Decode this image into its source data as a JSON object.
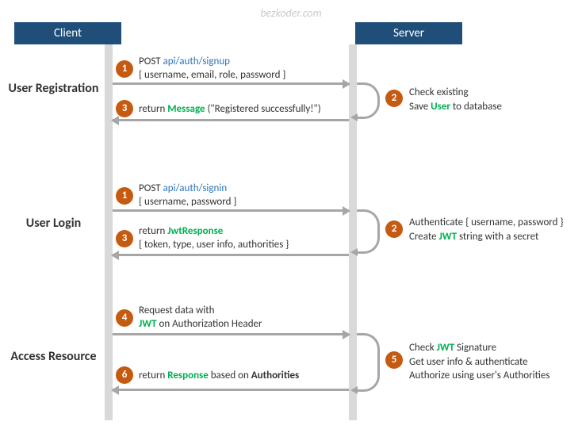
{
  "watermark": "bezkoder.com",
  "headers": {
    "client": "Client",
    "server": "Server"
  },
  "sections": {
    "registration": "User Registration",
    "login": "User Login",
    "access": "Access Resource"
  },
  "badges": {
    "b1": "1",
    "b2": "2",
    "b3": "3",
    "b4": "4",
    "b5": "5",
    "b6": "6"
  },
  "reg": {
    "step1": {
      "method": "POST ",
      "endpoint": "api/auth/signup",
      "body": "{ username, email, role, password }"
    },
    "step2": {
      "line1": "Check existing",
      "save_pre": "Save ",
      "save_hl": "User",
      "save_post": " to database"
    },
    "step3": {
      "ret": "return ",
      "hl": "Message",
      "post": " (\"Registered successfully!\")"
    }
  },
  "login": {
    "step1": {
      "method": "POST ",
      "endpoint": "api/auth/signin",
      "body": "{ username, password }"
    },
    "step2": {
      "line1": "Authenticate { username, password }",
      "create_pre": "Create ",
      "create_hl": "JWT",
      "create_post": " string with a secret"
    },
    "step3": {
      "ret": "return ",
      "hl": "JwtResponse",
      "body": "{ token, type, user info, authorities }"
    }
  },
  "access": {
    "step4": {
      "line1": "Request  data with",
      "hl": "JWT",
      "post": " on Authorization Header"
    },
    "step5": {
      "check_pre": "Check ",
      "check_hl": "JWT",
      "check_post": " Signature",
      "line2": "Get user info & authenticate",
      "line3": "Authorize using user's Authorities"
    },
    "step6": {
      "ret": "return ",
      "hl": "Response",
      "mid": " based on ",
      "hl2": "Authorities"
    }
  }
}
